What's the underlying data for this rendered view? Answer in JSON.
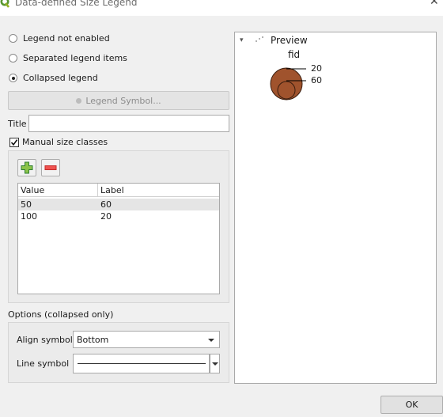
{
  "window": {
    "title": "Data-defined Size Legend",
    "close_icon": "close-icon"
  },
  "legend_mode": {
    "options": [
      {
        "label": "Legend not enabled",
        "selected": false
      },
      {
        "label": "Separated legend items",
        "selected": false
      },
      {
        "label": "Collapsed legend",
        "selected": true
      }
    ]
  },
  "legend_symbol_button": {
    "label": "Legend Symbol...",
    "enabled": false
  },
  "title_field": {
    "label": "Title",
    "value": ""
  },
  "manual_size_classes": {
    "label": "Manual size classes",
    "checked": true
  },
  "classes_table": {
    "columns": [
      "Value",
      "Label"
    ],
    "rows": [
      {
        "value": "50",
        "label": "60"
      },
      {
        "value": "100",
        "label": "20"
      }
    ]
  },
  "options": {
    "section_label": "Options (collapsed only)",
    "align_symbols_label": "Align symbols",
    "align_symbols_value": "Bottom",
    "line_symbol_label": "Line symbol"
  },
  "preview": {
    "header": "Preview",
    "field": "fid",
    "labels": [
      "20",
      "60"
    ],
    "symbol_color": "#a0532d"
  },
  "ok_button": {
    "label": "OK"
  }
}
